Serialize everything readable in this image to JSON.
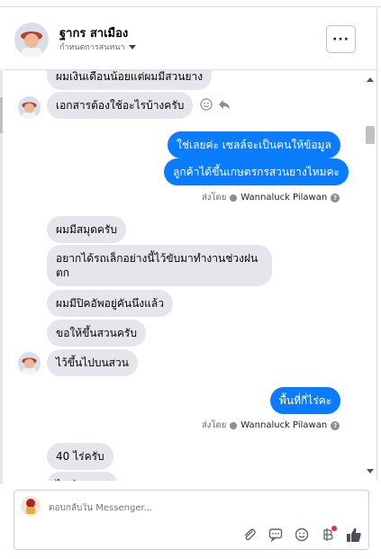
{
  "header": {
    "name": "ฐากร สาเมือง",
    "assign_label": "กำหนดการสนทนา",
    "more_label": "···"
  },
  "messages": {
    "m0": "ผมเงินเดือนน้อยแต่ผมมีสวนยาง",
    "m1": "เอกสารต้องใช้อะไรบ้างครับ",
    "m2": "ใช่เลยค่ะ เซลล์จะเป็นคนให้ข้อมูล",
    "m3": "ลูกค้าได้ขึ้นเกษตรกรสวนยางไหมคะ",
    "m4": "ผมมีสมุดครับ",
    "m5_line1": "อยากได้รถเล็กอย่างนี้ไว้ขับมาทำงานช่วงฝน",
    "m5_line2": "ตก",
    "m6": "ผมมีปิคอัพอยู่คันนึงแล้ว",
    "m7": "ขอให้ขึ้นสวนครับ",
    "m8": "ไว้ขึ้นไปบนสวน",
    "m9": "พื้นที่กี่ไร่คะ",
    "m10": "40 ไร่ครับ",
    "m11": "ไม่เปิดเผยบ่"
  },
  "sent_by": {
    "label": "ส่งโดย",
    "agent": "Wannaluck Pilawan"
  },
  "composer": {
    "placeholder": "ตอบกลับใน Messenger..."
  },
  "icons": {
    "attach": "paperclip-icon",
    "saved_reply": "speech-bubble-icon",
    "emoji": "smiley-icon",
    "payment": "baht-icon",
    "like": "thumbs-up-icon"
  },
  "colors": {
    "outgoing": "#0a7cff",
    "incoming": "#e4e6eb",
    "badge": "#f02849"
  }
}
